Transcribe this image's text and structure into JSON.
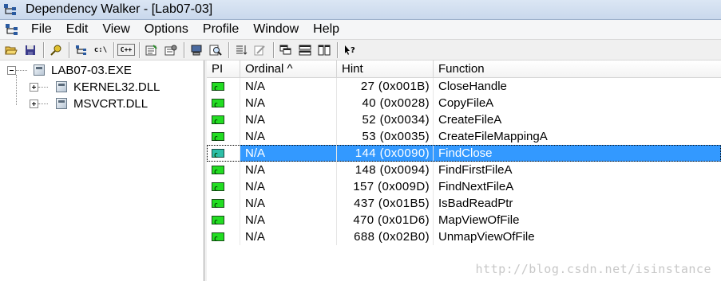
{
  "window": {
    "title": "Dependency Walker - [Lab07-03]"
  },
  "menubar": {
    "items": [
      "File",
      "Edit",
      "View",
      "Options",
      "Profile",
      "Window",
      "Help"
    ]
  },
  "toolbar": {
    "c_drive_label": "c:\\",
    "cpp_label": "C++"
  },
  "tree": {
    "root": {
      "label": "LAB07-03.EXE"
    },
    "children": [
      {
        "label": "KERNEL32.DLL"
      },
      {
        "label": "MSVCRT.DLL"
      }
    ]
  },
  "table": {
    "columns": {
      "pi": "PI",
      "ordinal": "Ordinal ^",
      "hint": "Hint",
      "function": "Function"
    },
    "rows": [
      {
        "ordinal": "N/A",
        "hint": "27 (0x001B)",
        "function": "CloseHandle",
        "icon": "green"
      },
      {
        "ordinal": "N/A",
        "hint": "40 (0x0028)",
        "function": "CopyFileA",
        "icon": "green"
      },
      {
        "ordinal": "N/A",
        "hint": "52 (0x0034)",
        "function": "CreateFileA",
        "icon": "green"
      },
      {
        "ordinal": "N/A",
        "hint": "53 (0x0035)",
        "function": "CreateFileMappingA",
        "icon": "green"
      },
      {
        "ordinal": "N/A",
        "hint": "144 (0x0090)",
        "function": "FindClose",
        "icon": "teal",
        "selected": true
      },
      {
        "ordinal": "N/A",
        "hint": "148 (0x0094)",
        "function": "FindFirstFileA",
        "icon": "green"
      },
      {
        "ordinal": "N/A",
        "hint": "157 (0x009D)",
        "function": "FindNextFileA",
        "icon": "green"
      },
      {
        "ordinal": "N/A",
        "hint": "437 (0x01B5)",
        "function": "IsBadReadPtr",
        "icon": "green"
      },
      {
        "ordinal": "N/A",
        "hint": "470 (0x01D6)",
        "function": "MapViewOfFile",
        "icon": "green"
      },
      {
        "ordinal": "N/A",
        "hint": "688 (0x02B0)",
        "function": "UnmapViewOfFile",
        "icon": "green"
      }
    ]
  },
  "watermark": "http://blog.csdn.net/isinstance",
  "colors": {
    "selection": "#3399ff",
    "import_icon": "#22dd22",
    "import_icon_selected": "#2dbfa8"
  }
}
